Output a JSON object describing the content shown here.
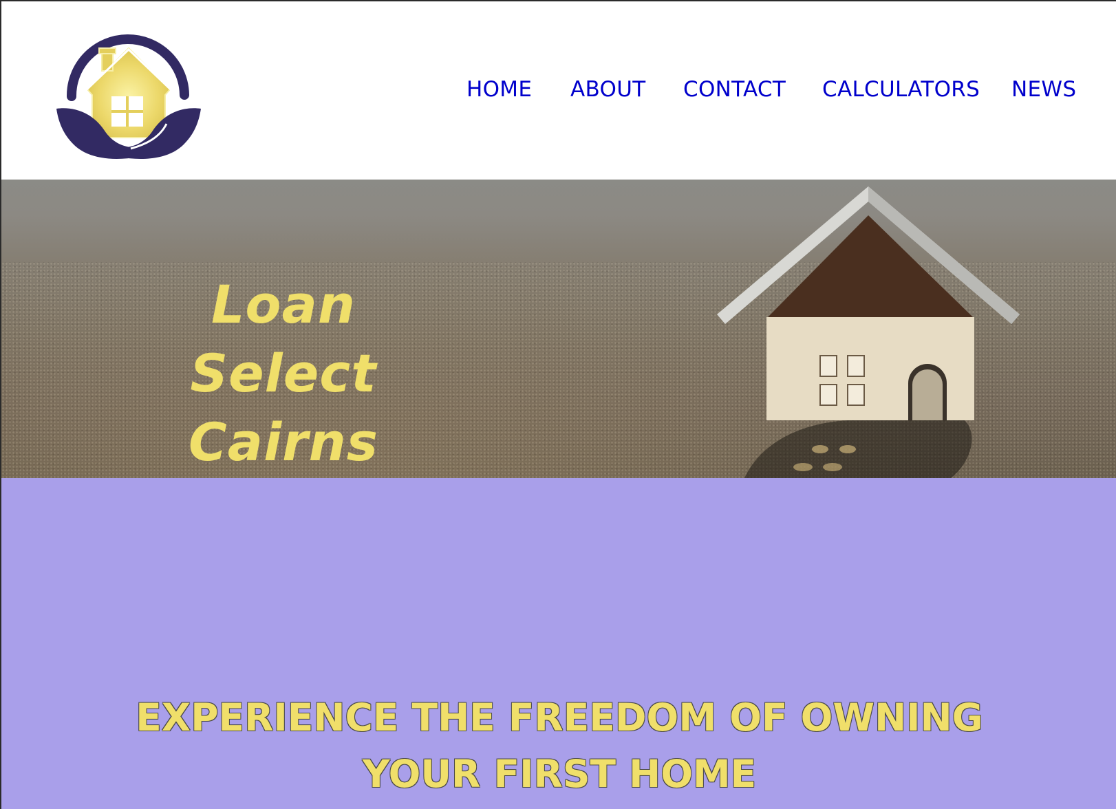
{
  "nav": {
    "items": [
      {
        "label": "HOME"
      },
      {
        "label": "ABOUT"
      },
      {
        "label": "CONTACT"
      },
      {
        "label": "CALCULATORS"
      },
      {
        "label": "NEWS"
      }
    ]
  },
  "hero": {
    "title_line1": "Loan Select",
    "title_line2": "Cairns"
  },
  "band": {
    "tagline_line1": "EXPERIENCE THE FREEDOM OF OWNING",
    "tagline_line2": "YOUR FIRST HOME"
  },
  "colors": {
    "nav_link": "#0000cc",
    "accent_yellow": "#f0df6a",
    "band_purple": "#a99fea",
    "logo_navy": "#322a63"
  },
  "icons": {
    "logo": "house-in-hands-logo",
    "hero_image": "model-house-on-sand"
  }
}
